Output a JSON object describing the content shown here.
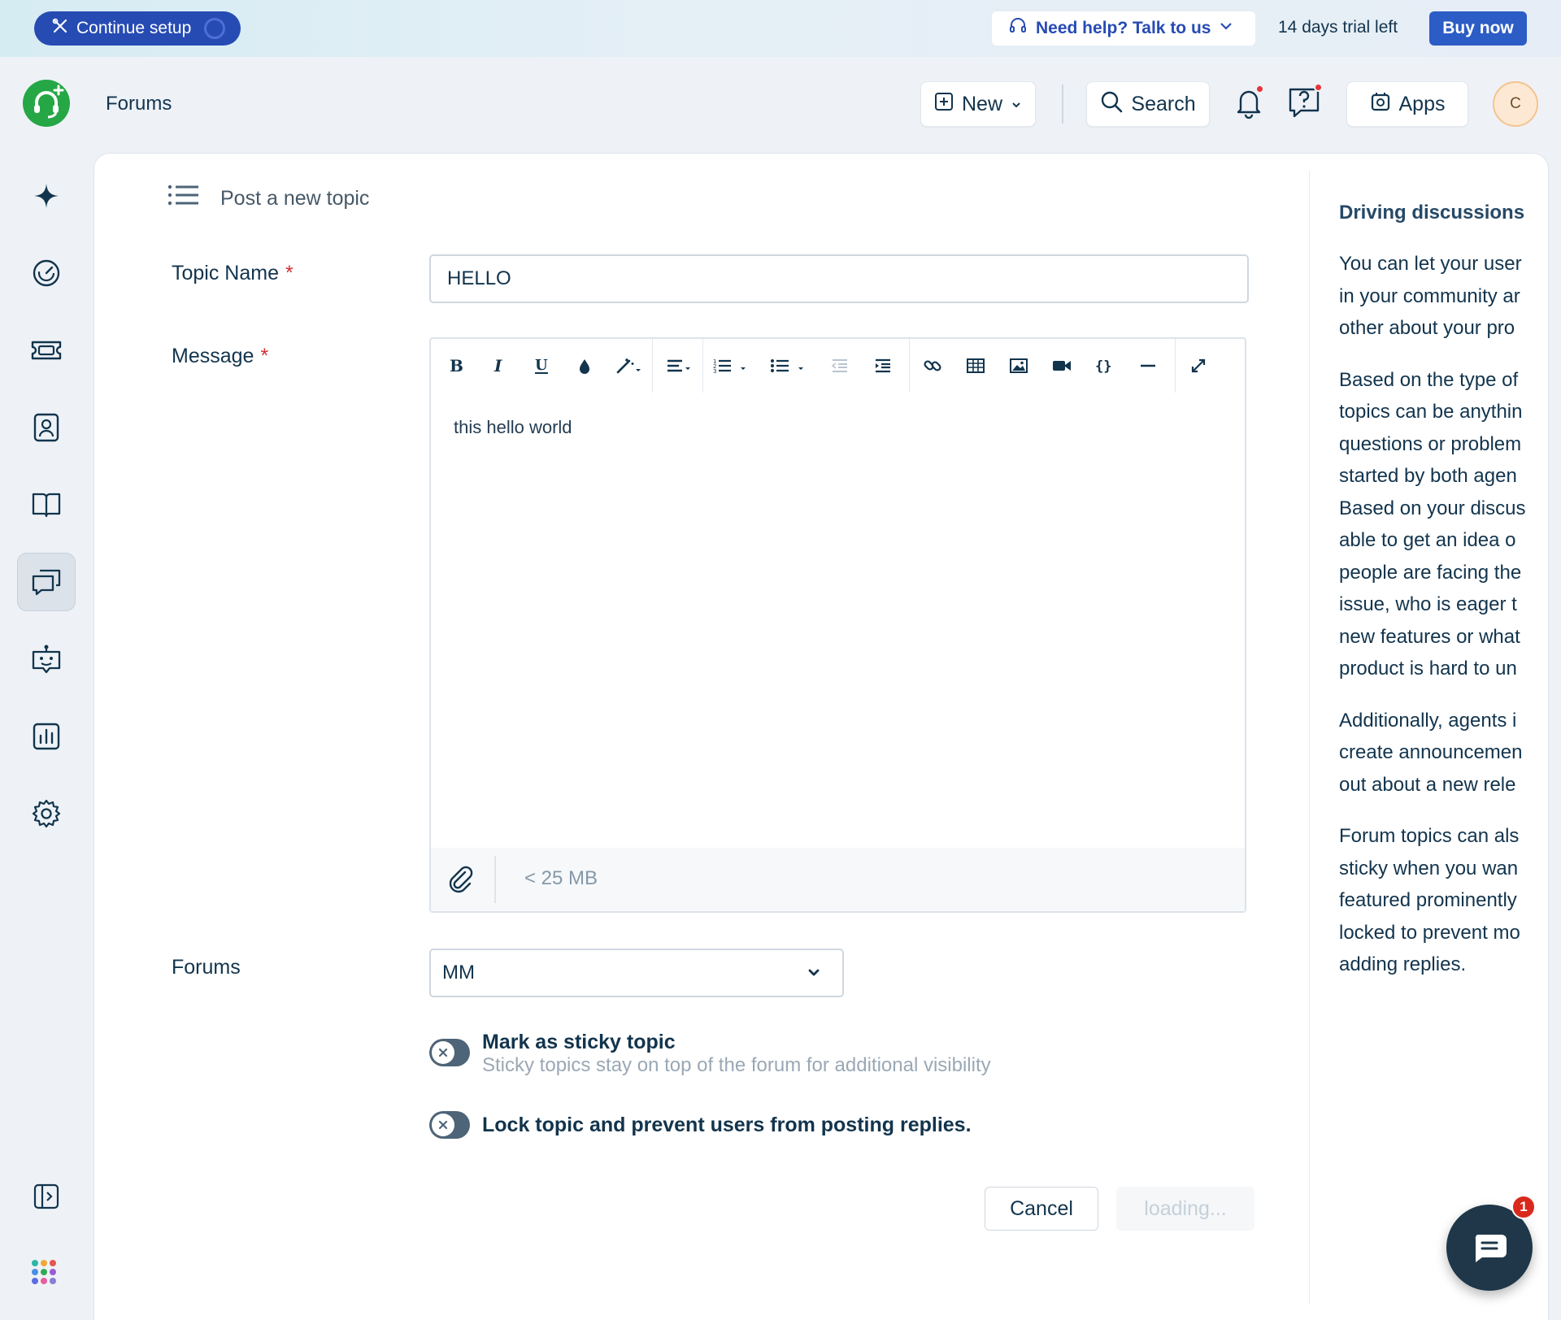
{
  "trial_bar": {
    "continue_setup_label": "Continue setup",
    "help_label": "Need help? Talk to us",
    "trial_text": "14 days trial left",
    "buy_label": "Buy now"
  },
  "header": {
    "page_title": "Forums",
    "new_label": "New",
    "search_label": "Search",
    "apps_label": "Apps",
    "avatar_initial": "C"
  },
  "sidebar": {
    "items": [
      {
        "icon": "sparkle-icon"
      },
      {
        "icon": "dashboard-icon"
      },
      {
        "icon": "tickets-icon"
      },
      {
        "icon": "contacts-icon"
      },
      {
        "icon": "solutions-book-icon"
      },
      {
        "icon": "forums-icon",
        "active": true
      },
      {
        "icon": "bot-icon"
      },
      {
        "icon": "analytics-icon"
      },
      {
        "icon": "settings-icon"
      }
    ],
    "bottom": [
      {
        "icon": "expand-panel-icon"
      },
      {
        "icon": "app-switcher-icon"
      }
    ]
  },
  "form": {
    "heading": "Post a new topic",
    "topic_name_label": "Topic Name",
    "topic_name_value": "HELLO",
    "message_label": "Message",
    "message_body": "this hello world",
    "attachment_limit": "< 25 MB",
    "forums_label": "Forums",
    "forums_selected": "MM",
    "sticky_title": "Mark as sticky topic",
    "sticky_desc": "Sticky topics stay on top of the forum for additional visibility",
    "lock_title": "Lock topic and prevent users from posting replies.",
    "cancel_label": "Cancel",
    "submit_label": "loading...",
    "required_mark": "*"
  },
  "editor_toolbar": [
    "bold",
    "italic",
    "underline",
    "text-color",
    "magic-format",
    "align",
    "ordered-list",
    "unordered-list",
    "outdent",
    "indent",
    "link",
    "table",
    "image",
    "video",
    "code",
    "horizontal-rule",
    "fullscreen"
  ],
  "info_panel": {
    "title": "Driving discussions",
    "paragraphs": [
      [
        "You can let your user",
        "in your community ar",
        "other about your pro"
      ],
      [
        "Based on the type of",
        "topics can be anythin",
        "questions or problem",
        "started by both agen",
        "Based on your discus",
        "able to get an idea o",
        "people are facing the",
        "issue, who is eager t",
        "new features or what",
        "product is hard to un"
      ],
      [
        "Additionally, agents i",
        "create announcemen",
        "out about a new rele"
      ],
      [
        "Forum topics can als",
        "sticky when you wan",
        "featured prominently",
        "locked to prevent mo",
        "adding replies."
      ]
    ]
  },
  "chat": {
    "badge_count": "1"
  },
  "colors": {
    "brand_blue": "#264bb3",
    "buy_blue": "#2c5cc5",
    "logo_green": "#25a745",
    "required_red": "#d72d30",
    "badge_red": "#d9291d"
  }
}
